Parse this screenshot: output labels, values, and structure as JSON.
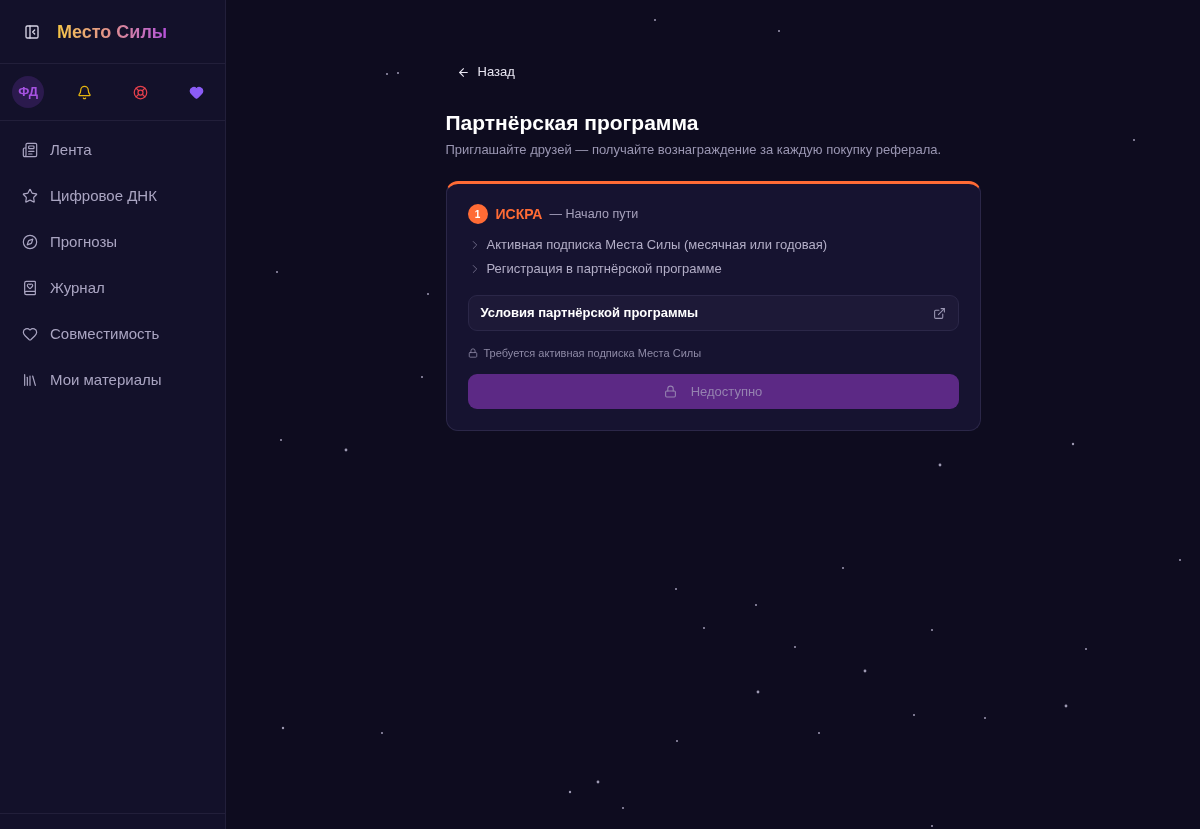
{
  "sidebar": {
    "title": "Место Силы",
    "avatar": {
      "initials": "ФД"
    },
    "nav": [
      {
        "label": "Лента",
        "selected": false
      },
      {
        "label": "Цифровое ДНК",
        "selected": false
      },
      {
        "label": "Прогнозы",
        "selected": false
      },
      {
        "label": "Журнал",
        "selected": false
      },
      {
        "label": "Совместимость",
        "selected": false
      },
      {
        "label": "Мои материалы",
        "selected": false
      }
    ]
  },
  "main": {
    "back": {
      "label": "Назад"
    },
    "title": "Партнёрская программа",
    "subtitle": "Приглашайте друзей — получайте вознаграждение за каждую покупку реферала.",
    "tier_card": {
      "number": "1",
      "name": "ИСКРА",
      "tagline": "— Начало пути",
      "requirements": [
        "Активная подписка Места Силы (месячная или годовая)",
        "Регистрация в партнёрской программе"
      ],
      "terms_link": {
        "label": "Условия партнёрской программы"
      },
      "notice": "Требуется активная подписка Места Силы",
      "action": {
        "label": "Недоступно",
        "disabled": true
      }
    }
  }
}
